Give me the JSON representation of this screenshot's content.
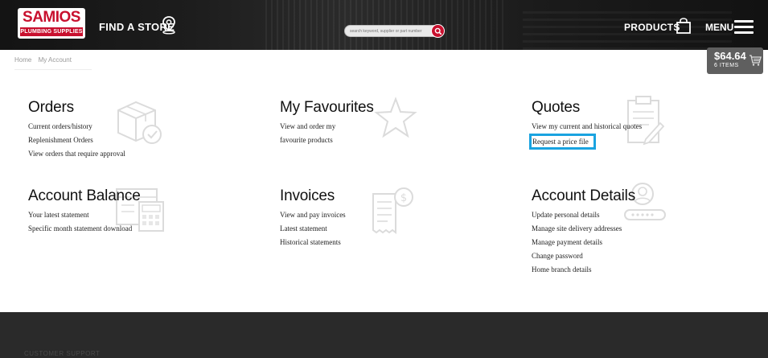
{
  "header": {
    "logo_text": "SAMIOS",
    "logo_sub": "PLUMBING SUPPLIES",
    "find_store": "FIND A STORE",
    "search_placeholder": "search keyword, supplier or part number",
    "products": "PRODUCTS",
    "menu": "MENU"
  },
  "breadcrumb": {
    "home": "Home",
    "current": "My Account"
  },
  "cart": {
    "amount": "$64.64",
    "items": "6 ITEMS"
  },
  "tiles": {
    "orders": {
      "title": "Orders",
      "links": [
        "Current orders/history",
        "Replenishment Orders",
        "View orders that require approval"
      ]
    },
    "favourites": {
      "title": "My Favourites",
      "links": [
        "View and order my",
        "favourite products"
      ]
    },
    "quotes": {
      "title": "Quotes",
      "links": [
        "View my current and historical quotes",
        "Request a price file"
      ]
    },
    "balance": {
      "title": "Account Balance",
      "links": [
        "Your latest statement",
        "Specific month statement download"
      ]
    },
    "invoices": {
      "title": "Invoices",
      "links": [
        "View and pay invoices",
        "Latest statement",
        "Historical statements"
      ]
    },
    "details": {
      "title": "Account Details",
      "links": [
        "Update personal details",
        "Manage site delivery addresses",
        "Manage payment details",
        "Change password",
        "Home branch details"
      ]
    }
  },
  "footer": {
    "support": "CUSTOMER SUPPORT"
  },
  "colors": {
    "brand_red": "#c8102e",
    "highlight": "#1aa3e0",
    "header_bg": "#1d1d1d",
    "footer_bg": "#2a2a2a"
  }
}
